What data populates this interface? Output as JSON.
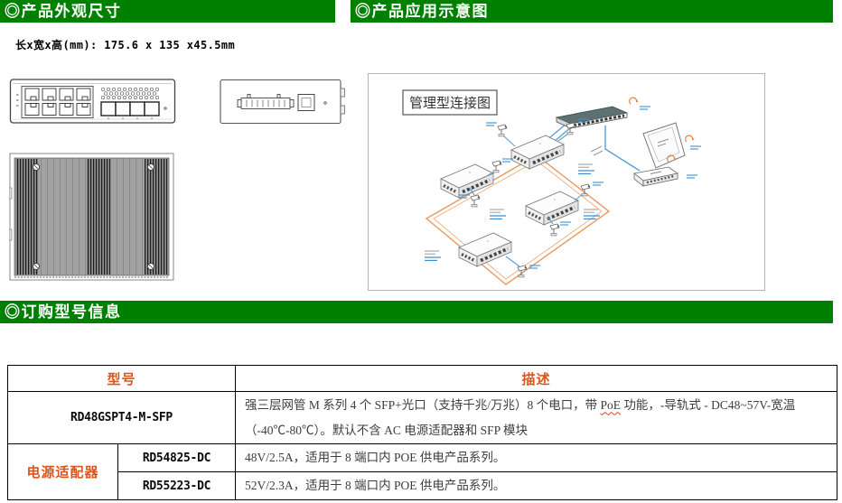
{
  "colors": {
    "header_green": "#008000",
    "header_text": "#ffffff",
    "accent_orange": "#d9571f",
    "diagram_blue": "#3f8fd0",
    "diagram_orange": "#e8995f"
  },
  "sections": {
    "appearance": {
      "title": "◎产品外观尺寸",
      "dimensions_label": "长x宽x高(mm): 175.6 x 135 x45.5mm"
    },
    "application": {
      "title": "◎产品应用示意图",
      "diagram_title": "管理型连接图"
    },
    "ordering": {
      "title": "◎订购型号信息"
    }
  },
  "table": {
    "headers": {
      "model": "型号",
      "description": "描述"
    },
    "rows": [
      {
        "model": "RD48GSPT4-M-SFP",
        "desc_before_poe": "强三层网管 M 系列 4 个 SFP+光口（支持千兆/万兆）8 个电口，带 ",
        "poe": "PoE",
        "desc_after_poe": " 功能，-导轨式  - DC48~57V-宽温（-40℃-80℃）。默认不含 AC 电源适配器和 SFP 模块"
      },
      {
        "group": "电源适配器",
        "model": "RD54825-DC",
        "description": "48V/2.5A，适用于 8 端口内 POE 供电产品系列。"
      },
      {
        "model": "RD55223-DC",
        "description": "52V/2.3A，适用于 8 端口内 POE 供电产品系列。"
      }
    ]
  }
}
